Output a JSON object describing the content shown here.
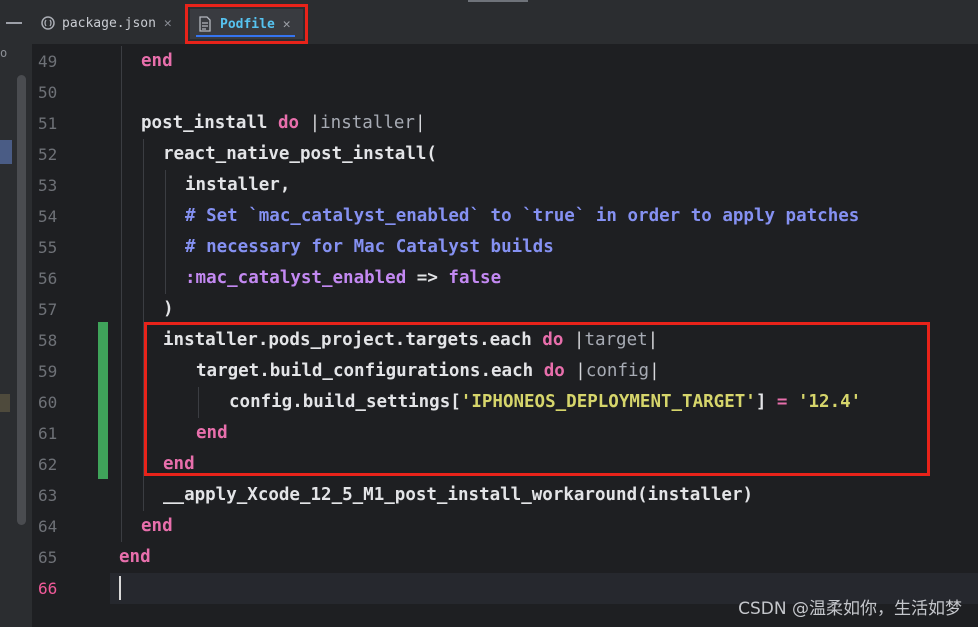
{
  "tabs": [
    {
      "label": "package.json",
      "active": false
    },
    {
      "label": "Podfile",
      "active": true
    }
  ],
  "colors": {
    "keyword": "#e86fac",
    "comment": "#8591f2",
    "symbol": "#c389f2",
    "string": "#d6d56b",
    "highlight_box": "#e8231a",
    "active_tab_text": "#56c3f0"
  },
  "editor": {
    "current_line": "66",
    "lines": [
      {
        "no": "49",
        "parts": [
          {
            "t": "end",
            "c": "kw"
          }
        ]
      },
      {
        "no": "50",
        "parts": []
      },
      {
        "no": "51",
        "parts": [
          {
            "t": "post_install "
          },
          {
            "t": "do",
            "c": "kw"
          },
          {
            "t": " |",
            "c": "pipe"
          },
          {
            "t": "installer",
            "c": "param"
          },
          {
            "t": "|",
            "c": "pipe"
          }
        ]
      },
      {
        "no": "52",
        "parts": [
          {
            "t": "react_native_post_install("
          }
        ]
      },
      {
        "no": "53",
        "parts": [
          {
            "t": "installer,"
          }
        ]
      },
      {
        "no": "54",
        "parts": [
          {
            "t": "# Set `mac_catalyst_enabled` to `true` in order to apply patches",
            "c": "com"
          }
        ]
      },
      {
        "no": "55",
        "parts": [
          {
            "t": "# necessary for Mac Catalyst builds",
            "c": "com"
          }
        ]
      },
      {
        "no": "56",
        "parts": [
          {
            "t": ":mac_catalyst_enabled",
            "c": "sym"
          },
          {
            "t": " => "
          },
          {
            "t": "false",
            "c": "sym"
          }
        ]
      },
      {
        "no": "57",
        "parts": [
          {
            "t": ")"
          }
        ]
      },
      {
        "no": "58",
        "parts": [
          {
            "t": "installer.pods_project.targets.each "
          },
          {
            "t": "do",
            "c": "kw"
          },
          {
            "t": " |",
            "c": "pipe"
          },
          {
            "t": "target",
            "c": "param"
          },
          {
            "t": "|",
            "c": "pipe"
          }
        ]
      },
      {
        "no": "59",
        "parts": [
          {
            "t": "target.build_configurations.each "
          },
          {
            "t": "do",
            "c": "kw"
          },
          {
            "t": " |",
            "c": "pipe"
          },
          {
            "t": "config",
            "c": "param"
          },
          {
            "t": "|",
            "c": "pipe"
          }
        ]
      },
      {
        "no": "60",
        "parts": [
          {
            "t": "config.build_settings["
          },
          {
            "t": "'IPHONEOS_DEPLOYMENT_TARGET'",
            "c": "str"
          },
          {
            "t": "] "
          },
          {
            "t": "=",
            "c": "kw"
          },
          {
            "t": " "
          },
          {
            "t": "'12.4'",
            "c": "str"
          }
        ]
      },
      {
        "no": "61",
        "parts": [
          {
            "t": "end",
            "c": "kw"
          }
        ]
      },
      {
        "no": "62",
        "parts": [
          {
            "t": "end",
            "c": "kw"
          }
        ]
      },
      {
        "no": "63",
        "parts": [
          {
            "t": "__apply_Xcode_12_5_M1_post_install_workaround(installer)"
          }
        ]
      },
      {
        "no": "64",
        "parts": [
          {
            "t": "end",
            "c": "kw"
          }
        ]
      },
      {
        "no": "65",
        "parts": [
          {
            "t": "end",
            "c": "kw"
          }
        ]
      },
      {
        "no": "66",
        "parts": []
      }
    ]
  },
  "watermark": "CSDN @温柔如你，生活如梦"
}
